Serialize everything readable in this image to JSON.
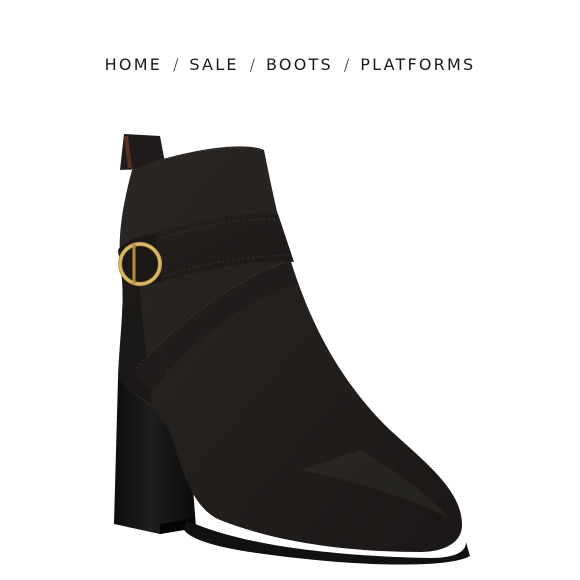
{
  "breadcrumb": {
    "items": [
      {
        "label": "HOME"
      },
      {
        "label": "SALE"
      },
      {
        "label": "BOOTS"
      },
      {
        "label": "PLATFORMS"
      }
    ],
    "separator": "/"
  },
  "product": {
    "image_icon": "ankle-boot-image",
    "colors": {
      "suede": "#221f1d",
      "heel": "#141414",
      "buckle": "#c9a24f",
      "background": "#ffffff"
    }
  }
}
